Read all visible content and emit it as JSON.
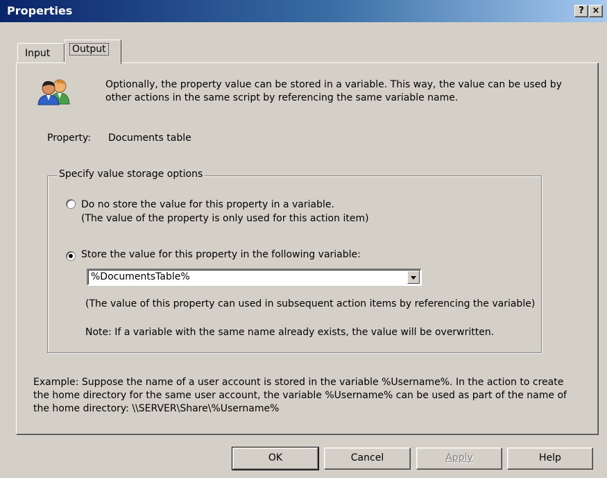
{
  "window": {
    "title": "Properties",
    "help_button": "?",
    "close_button": "×"
  },
  "tabs": [
    {
      "label": "Input",
      "active": false
    },
    {
      "label": "Output",
      "active": true
    }
  ],
  "output": {
    "icon": "users-icon",
    "description": "Optionally, the property value can be stored in a variable. This way, the value can be used by other actions in the same script by referencing the same variable name.",
    "property_label": "Property:",
    "property_value": "Documents table",
    "group_title": "Specify value storage options",
    "option_no_store": {
      "line1": "Do no store the value for this property in a variable.",
      "line2": "(The value of the property is only used for this action item)",
      "checked": false
    },
    "option_store": {
      "label": "Store the value for this property in the following variable:",
      "checked": true
    },
    "variable_value": "%DocumentsTable%",
    "note_usage": "(The value of this property can used in subsequent action items by referencing the variable)",
    "note_overwrite": "Note: If a variable with the same name already exists, the value will be overwritten.",
    "example": "Example: Suppose the name of a user account is stored in the variable %Username%. In the action to create the home directory for the same user account, the variable %Username% can be used as part of the name of the home directory: \\\\SERVER\\Share\\%Username%"
  },
  "buttons": {
    "ok": "OK",
    "cancel": "Cancel",
    "apply": "Apply",
    "help": "Help"
  }
}
